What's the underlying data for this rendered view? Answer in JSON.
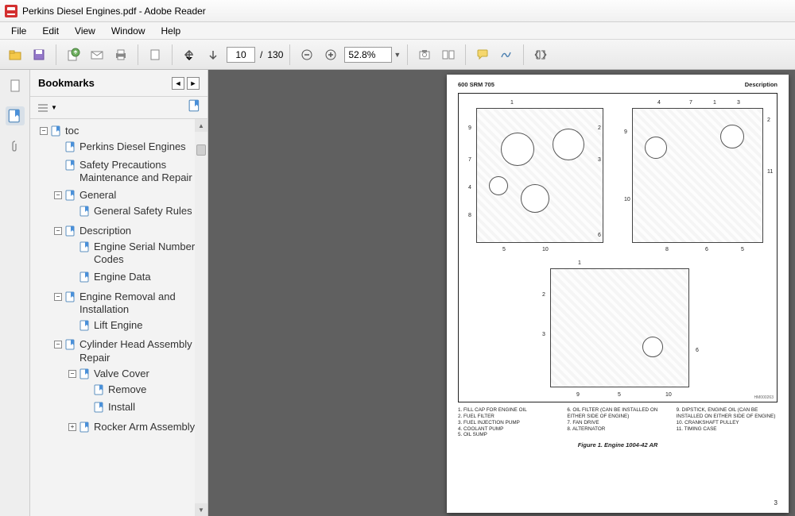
{
  "title": "Perkins Diesel Engines.pdf - Adobe Reader",
  "menu": {
    "file": "File",
    "edit": "Edit",
    "view": "View",
    "window": "Window",
    "help": "Help"
  },
  "toolbar": {
    "page_current": "10",
    "page_sep": "/",
    "page_total": "130",
    "zoom": "52.8%"
  },
  "bookmarks": {
    "title": "Bookmarks",
    "tree": {
      "toc": "toc",
      "toc_children": {
        "pde": "Perkins Diesel Engines",
        "safety": "Safety Precautions Maintenance and Repair",
        "general": "General",
        "general_children": {
          "gsr": "General Safety Rules"
        },
        "desc": "Description",
        "desc_children": {
          "esnc": "Engine Serial Number Codes",
          "edata": "Engine Data"
        },
        "eri": "Engine Removal and Installation",
        "eri_children": {
          "lift": "Lift Engine"
        },
        "char": "Cylinder Head Assembly Repair",
        "char_children": {
          "valve": "Valve Cover",
          "valve_children": {
            "remove": "Remove",
            "install": "Install"
          },
          "rocker": "Rocker Arm Assembly"
        }
      }
    }
  },
  "doc": {
    "header_left": "600 SRM 705",
    "header_right": "Description",
    "caption": "Figure 1. Engine 1004-42 AR",
    "image_id": "HM000263",
    "page_num": "3",
    "legend_col1": {
      "1": "1.  FILL CAP FOR ENGINE OIL",
      "2": "2.  FUEL FILTER",
      "3": "3.  FUEL INJECTION PUMP",
      "4": "4.  COOLANT PUMP",
      "5": "5.  OIL SUMP"
    },
    "legend_col2": {
      "6": "6.  OIL FILTER (CAN BE INSTALLED ON EITHER SIDE OF ENGINE)",
      "7": "7.  FAN DRIVE",
      "8": "8.  ALTERNATOR"
    },
    "legend_col3": {
      "9": "9.  DIPSTICK, ENGINE OIL (CAN BE INSTALLED ON EITHER SIDE OF ENGINE)",
      "10": "10. CRANKSHAFT PULLEY",
      "11": "11. TIMING CASE"
    }
  }
}
